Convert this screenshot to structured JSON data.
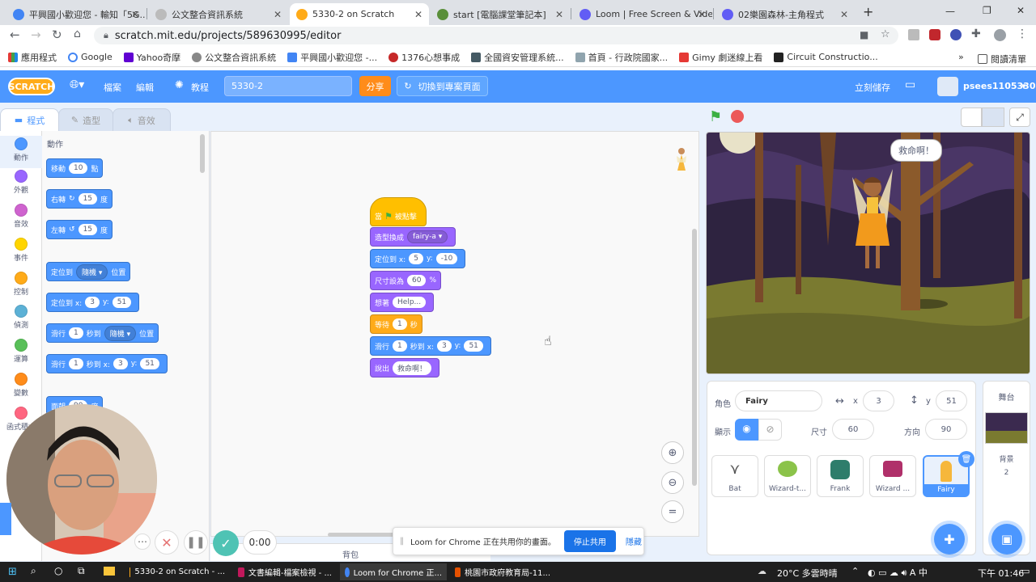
{
  "browser": {
    "tabs": [
      {
        "label": "平興國小歡迎您 - 輸知「5G...",
        "color": "#4285f4"
      },
      {
        "label": "公文整合資訊系統",
        "color": "#888"
      },
      {
        "label": "5330-2 on Scratch",
        "color": "#ffab19"
      },
      {
        "label": "start [電腦課堂筆記本]",
        "color": "#5a8f3a"
      },
      {
        "label": "Loom | Free Screen & Vide...",
        "color": "#625df5"
      },
      {
        "label": "02樂園森林-主角程式",
        "color": "#625df5"
      }
    ],
    "new_tab": "+",
    "url": "scratch.mit.edu/projects/589630995/editor",
    "bookmarks": [
      "應用程式",
      "Google",
      "Yahoo奇摩",
      "公文整合資訊系統",
      "平興國小歡迎您 -...",
      "1376心想事成",
      "全國資安管理系統...",
      "首頁 - 行政院國家...",
      "Gimy 劇迷線上看",
      "Circuit Constructio...",
      "閱讀清單"
    ],
    "bookmarks_more": "»"
  },
  "scratch": {
    "logo": "SCRATCH",
    "menu": {
      "file": "檔案",
      "edit": "編輯",
      "tutorials": "教程",
      "project_title": "5330-2",
      "share": "分享",
      "see_project": "切換到專案頁面",
      "save_now": "立刻儲存",
      "username": "psees1105330"
    },
    "editor_tabs": [
      "程式",
      "造型",
      "音效"
    ],
    "categories": [
      {
        "label": "動作",
        "color": "#4c97ff"
      },
      {
        "label": "外觀",
        "color": "#9966ff"
      },
      {
        "label": "音效",
        "color": "#cf63cf"
      },
      {
        "label": "事件",
        "color": "#ffd500"
      },
      {
        "label": "控制",
        "color": "#ffab19"
      },
      {
        "label": "偵測",
        "color": "#5cb1d6"
      },
      {
        "label": "運算",
        "color": "#59c059"
      },
      {
        "label": "變數",
        "color": "#ff8c1a"
      },
      {
        "label": "函式積木",
        "color": "#ff6680"
      }
    ],
    "palette": {
      "heading": "動作",
      "move": {
        "a": "移動",
        "v": "10",
        "b": "點"
      },
      "turn_right": {
        "a": "右轉",
        "v": "15",
        "b": "度"
      },
      "turn_left": {
        "a": "左轉",
        "v": "15",
        "b": "度"
      },
      "goto": {
        "a": "定位到",
        "dd": "隨機 ▾",
        "b": "位置"
      },
      "gotoxy": {
        "a": "定位到 x:",
        "x": "3",
        "ylabel": "y:",
        "y": "51"
      },
      "glide": {
        "a": "滑行",
        "v": "1",
        "b": "秒到",
        "dd": "隨機 ▾",
        "c": "位置"
      },
      "glidexy": {
        "a": "滑行",
        "v": "1",
        "b": "秒到 x:",
        "x": "3",
        "ylabel": "y:",
        "y": "51"
      },
      "point": {
        "a": "面朝",
        "v": "90",
        "b": "度"
      }
    },
    "script": {
      "when_flag": {
        "a": "當",
        "b": "被點擊"
      },
      "switch_costume": {
        "a": "造型換成",
        "dd": "fairy-a ▾"
      },
      "gotoxy": {
        "a": "定位到 x:",
        "x": "5",
        "ylabel": "y:",
        "y": "-10"
      },
      "set_size": {
        "a": "尺寸設為",
        "v": "60",
        "b": "%"
      },
      "think": {
        "a": "想著",
        "v": "Help..."
      },
      "wait": {
        "a": "等待",
        "v": "1",
        "b": "秒"
      },
      "glide": {
        "a": "滑行",
        "v": "1",
        "b": "秒到 x:",
        "x": "3",
        "ylabel": "y:",
        "y": "51"
      },
      "say": {
        "a": "說出",
        "v": "救命啊！"
      }
    },
    "backpack": "背包",
    "stage": {
      "speech": "救命啊！"
    },
    "sprite_info": {
      "sprite_label": "角色",
      "sprite_name": "Fairy",
      "x_label": "x",
      "x": "3",
      "y_label": "y",
      "y": "51",
      "show_label": "顯示",
      "size_label": "尺寸",
      "size": "60",
      "direction_label": "方向",
      "direction": "90"
    },
    "sprites": [
      "Bat",
      "Wizard-t...",
      "Frank",
      "Wizard ...",
      "Fairy"
    ],
    "stage_panel": {
      "title": "舞台",
      "backdrops_label": "背景",
      "backdrops_count": "2"
    }
  },
  "loom": {
    "timer": "0:00",
    "sharing_text": "Loom for Chrome 正在共用你的畫面。",
    "stop_share": "停止共用",
    "hide": "隱藏"
  },
  "taskbar": {
    "items": [
      "5330-2 on Scratch - ...",
      "文書編輯-檔案檢視 - ...",
      "Loom for Chrome 正...",
      "桃園市政府教育局-11..."
    ],
    "weather": "20°C 多雲時晴",
    "time": "下午 01:46"
  }
}
